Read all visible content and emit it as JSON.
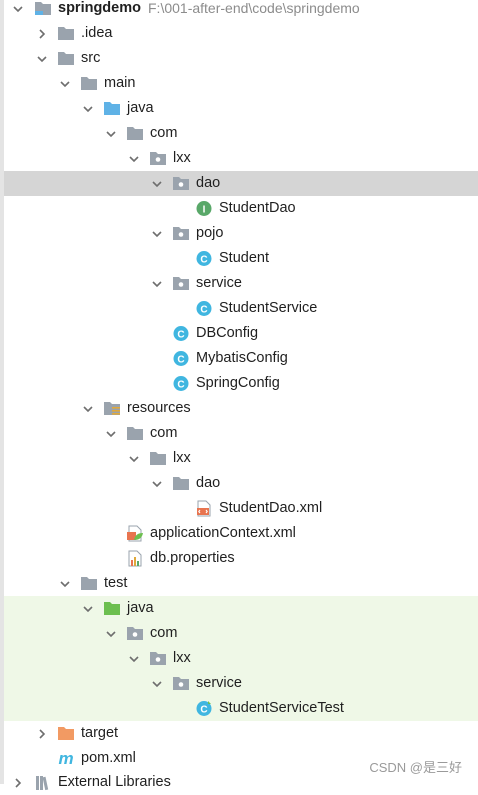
{
  "project": {
    "name": "springdemo",
    "path": "F:\\001-after-end\\code\\springdemo"
  },
  "tree": {
    "idea": ".idea",
    "src": "src",
    "main": "main",
    "java": "java",
    "com": "com",
    "lxx": "lxx",
    "dao": "dao",
    "student_dao": "StudentDao",
    "pojo": "pojo",
    "student": "Student",
    "service": "service",
    "student_service": "StudentService",
    "db_config": "DBConfig",
    "mybatis_config": "MybatisConfig",
    "spring_config": "SpringConfig",
    "resources": "resources",
    "res_com": "com",
    "res_lxx": "lxx",
    "res_dao": "dao",
    "student_dao_xml": "StudentDao.xml",
    "app_context": "applicationContext.xml",
    "db_properties": "db.properties",
    "test": "test",
    "test_java": "java",
    "test_com": "com",
    "test_lxx": "lxx",
    "test_service": "service",
    "student_service_test": "StudentServiceTest",
    "target": "target",
    "pom": "pom.xml",
    "external_libraries": "External Libraries"
  },
  "icon_letters": {
    "interface": "I",
    "class": "C",
    "maven": "m"
  },
  "watermark": "CSDN @是三好",
  "colors": {
    "folder": "#9aa3ad",
    "source_folder": "#5fb2e6",
    "test_folder": "#6cbf4f",
    "target_folder": "#f29a63",
    "interface_icon": "#59a869",
    "class_icon": "#40b6e0",
    "selected_row": "#d5d5d5",
    "test_row": "#eff8e7"
  }
}
